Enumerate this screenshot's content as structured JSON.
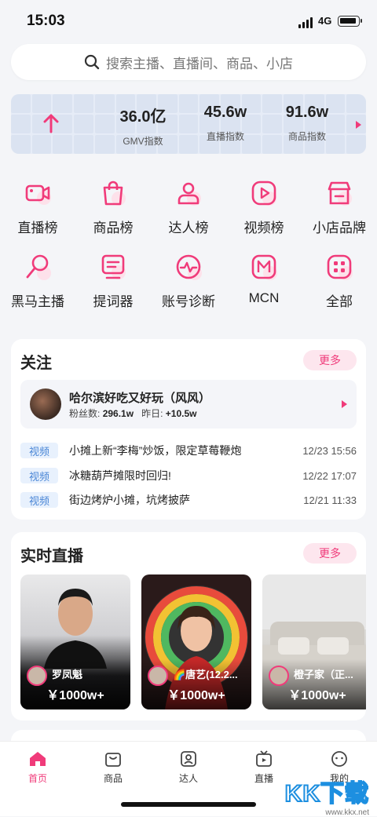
{
  "status_bar": {
    "time": "15:03",
    "network": "4G"
  },
  "search": {
    "placeholder": "搜索主播、直播间、商品、小店"
  },
  "stats": [
    {
      "value": "36.0亿",
      "label": "GMV指数"
    },
    {
      "value": "45.6w",
      "label": "直播指数"
    },
    {
      "value": "91.6w",
      "label": "商品指数"
    }
  ],
  "menu_row1": [
    {
      "label": "直播榜",
      "icon": "video-camera-icon"
    },
    {
      "label": "商品榜",
      "icon": "shopping-bag-icon"
    },
    {
      "label": "达人榜",
      "icon": "person-icon"
    },
    {
      "label": "视频榜",
      "icon": "play-icon"
    },
    {
      "label": "小店品牌",
      "icon": "store-icon"
    }
  ],
  "menu_row2": [
    {
      "label": "黑马主播",
      "icon": "magnifier-icon"
    },
    {
      "label": "提词器",
      "icon": "teleprompter-icon"
    },
    {
      "label": "账号诊断",
      "icon": "heartbeat-icon"
    },
    {
      "label": "MCN",
      "icon": "mcn-icon"
    },
    {
      "label": "全部",
      "icon": "grid-icon"
    }
  ],
  "follow": {
    "title": "关注",
    "more": "更多",
    "anchor": {
      "name": "哈尔滨好吃又好玩（风风）",
      "fans_label": "粉丝数:",
      "fans": "296.1w",
      "yesterday_label": "昨日:",
      "yesterday": "+10.5w"
    },
    "videos": [
      {
        "tag": "视频",
        "title": "小摊上新“李梅”炒饭，限定草莓鞭炮",
        "date": "12/23 15:56"
      },
      {
        "tag": "视频",
        "title": "冰糖葫芦摊限时回归!",
        "date": "12/22 17:07"
      },
      {
        "tag": "视频",
        "title": "街边烤炉小摊，坑烤披萨",
        "date": "12/21 11:33"
      }
    ]
  },
  "live": {
    "title": "实时直播",
    "more": "更多",
    "cards": [
      {
        "name": "罗凤魁",
        "value": "￥1000w+"
      },
      {
        "name": "🌈唐艺(12.2...",
        "value": "￥1000w+"
      },
      {
        "name": "橙子家（正...",
        "value": "￥1000w+"
      }
    ]
  },
  "tabbar": [
    {
      "label": "首页",
      "icon": "home-icon"
    },
    {
      "label": "商品",
      "icon": "bag-icon"
    },
    {
      "label": "达人",
      "icon": "user-card-icon"
    },
    {
      "label": "直播",
      "icon": "tv-icon"
    },
    {
      "label": "我的",
      "icon": "smile-icon"
    }
  ],
  "watermark": {
    "logo": "KK下载",
    "url": "www.kkx.net"
  },
  "colors": {
    "accent": "#f03b7a",
    "tag_blue": "#4a86d6",
    "background": "#f4f5f8"
  }
}
